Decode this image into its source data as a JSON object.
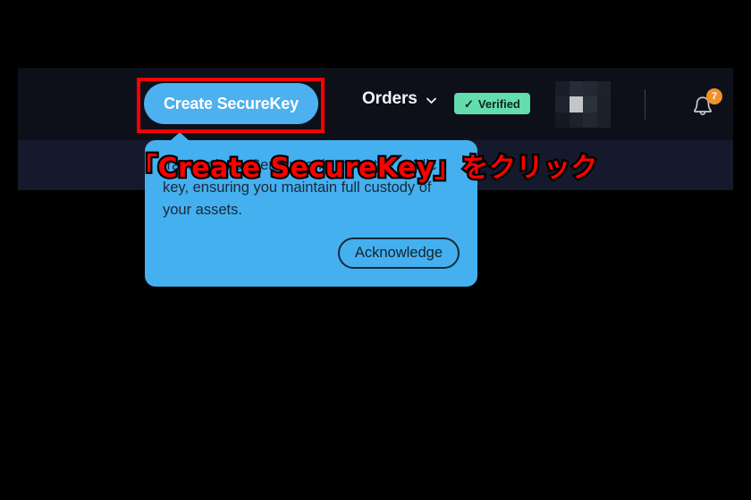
{
  "colors": {
    "page_background": "#000000",
    "topbar_background": "#0d1019",
    "subbar_background": "#141a2b",
    "primary_button": "#4db0ef",
    "tooltip_background": "#45b0ef",
    "verified_badge": "#63ddad",
    "notification_badge": "#f0912c",
    "annotation_red": "#ff0000",
    "divider": "#3c4350"
  },
  "topbar": {
    "create_key_button": {
      "label": "Create SecureKey",
      "icon": "none"
    },
    "orders_nav": {
      "label": "Orders",
      "icon": "chevron-down-icon"
    },
    "verified_badge": {
      "check": "✓",
      "label": "Verified"
    },
    "avatar": {
      "icon": "pixelated-avatar",
      "tiles": [
        "#181d27",
        "#262d38",
        "#222932",
        "#1c232d",
        "#1d242e",
        "#c3c6c9",
        "#2a323c",
        "#1a212b",
        "#141a24",
        "#1b222c",
        "#212831",
        "#1b212b"
      ]
    },
    "divider": {
      "icon": "vertical-divider"
    },
    "notifications": {
      "icon": "bell-icon",
      "badge_count": "7"
    }
  },
  "tooltip": {
    "body": "transactions. Servers only store the public key, ensuring you maintain full custody of your assets.",
    "acknowledge_label": "Acknowledge"
  },
  "annotation": {
    "caption": "「Create SecureKey」をクリック",
    "highlight_target": "create-key-button"
  }
}
